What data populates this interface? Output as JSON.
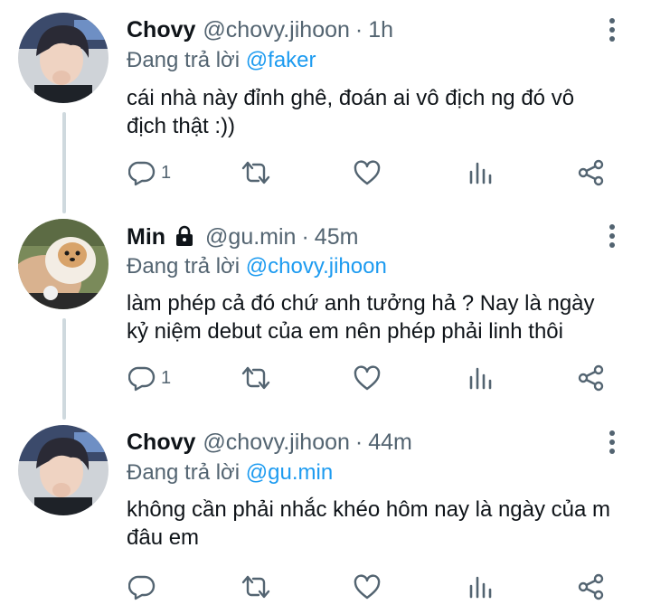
{
  "tweets": [
    {
      "name": "Chovy",
      "handle": "@chovy.jihoon",
      "dot": "·",
      "time": "1h",
      "reply_prefix": "Đang trả lời",
      "reply_to": "@faker",
      "text": "cái nhà này đỉnh ghê, đoán ai vô địch ng đó vô địch thật :))",
      "reply_count": "1",
      "locked": false,
      "avatar_icon": "chovy-avatar"
    },
    {
      "name": "Min",
      "handle": "@gu.min",
      "dot": "·",
      "time": "45m",
      "reply_prefix": "Đang trả lời",
      "reply_to": "@chovy.jihoon",
      "text": "làm phép cả đó chứ anh tưởng hả ? Nay là ngày kỷ niệm debut của em nên phép phải linh thôi",
      "reply_count": "1",
      "locked": true,
      "avatar_icon": "pomeranian-avatar"
    },
    {
      "name": "Chovy",
      "handle": "@chovy.jihoon",
      "dot": "·",
      "time": "44m",
      "reply_prefix": "Đang trả lời",
      "reply_to": "@gu.min",
      "text": "không cần phải nhắc khéo hôm nay là ngày của m đâu em",
      "reply_count": "",
      "locked": false,
      "avatar_icon": "chovy-avatar"
    }
  ],
  "icons": {
    "reply": "reply-icon",
    "retweet": "retweet-icon",
    "like": "heart-icon",
    "views": "analytics-icon",
    "share": "share-icon",
    "more": "more-vertical-icon",
    "lock": "lock-icon"
  },
  "colors": {
    "text": "#0f1419",
    "secondary": "#536471",
    "mention": "#1d9bf0",
    "thread_line": "#cfd9de"
  }
}
